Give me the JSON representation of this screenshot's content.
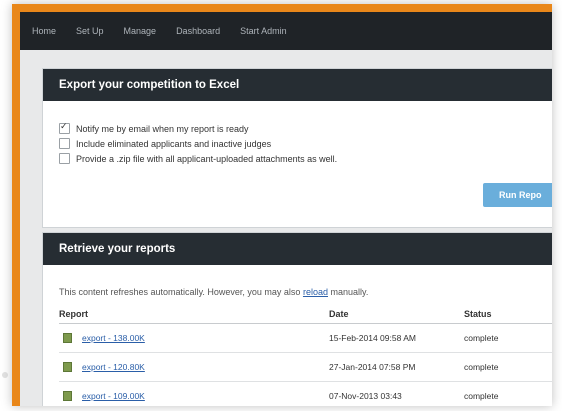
{
  "nav": {
    "items": [
      "Home",
      "Set Up",
      "Manage",
      "Dashboard",
      "Start Admin"
    ]
  },
  "export": {
    "title": "Export your competition to Excel",
    "options": [
      {
        "label": "Notify me by email when my report is ready",
        "checked": true
      },
      {
        "label": "Include eliminated applicants and inactive judges",
        "checked": false
      },
      {
        "label": "Provide a .zip file with all applicant-uploaded attachments as well.",
        "checked": false
      }
    ],
    "run_label": "Run Repo"
  },
  "retrieve": {
    "title": "Retrieve your reports",
    "info_before": "This content refreshes automatically. However, you may also ",
    "info_link": "reload",
    "info_after": " manually.",
    "columns": [
      "Report",
      "Date",
      "Status"
    ],
    "rows": [
      {
        "name": "export - 138.00K",
        "date": "15-Feb-2014 09:58 AM",
        "status": "complete"
      },
      {
        "name": "export - 120.80K",
        "date": "27-Jan-2014 07:58 PM",
        "status": "complete"
      },
      {
        "name": "export - 109.00K",
        "date": "07-Nov-2013 03:43",
        "status": "complete"
      }
    ]
  },
  "colors": {
    "frame": "#e9871a",
    "nav_bg": "#1f2327",
    "header_bg": "#262d33",
    "button": "#6aaedb",
    "link": "#2a5ea8"
  }
}
